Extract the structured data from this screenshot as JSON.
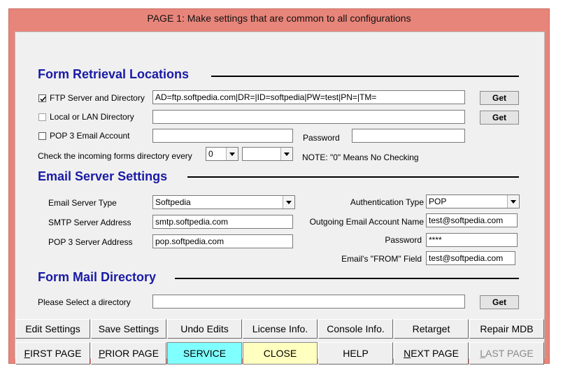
{
  "window": {
    "title": "PAGE 1: Make settings that are common to all configurations"
  },
  "retrieval": {
    "heading": "Form Retrieval Locations",
    "ftp": {
      "label": "FTP Server and Directory",
      "checked": true,
      "value": "AD=ftp.softpedia.com|DR=|ID=softpedia|PW=test|PN=|TM=",
      "get_label": "Get"
    },
    "lan": {
      "label": "Local or LAN Directory",
      "checked": false,
      "value": "",
      "get_label": "Get"
    },
    "pop3": {
      "label": "POP 3 Email Account",
      "checked": false,
      "value": "",
      "password_label": "Password",
      "password_value": ""
    },
    "check": {
      "label": "Check the incoming forms directory every",
      "interval_value": "0",
      "unit_value": "",
      "note": "NOTE: \"0\" Means No Checking"
    }
  },
  "email": {
    "heading": "Email Server Settings",
    "server_type_label": "Email Server Type",
    "server_type_value": "Softpedia",
    "smtp_label": "SMTP Server Address",
    "smtp_value": "smtp.softpedia.com",
    "pop3_label": "POP 3 Server Address",
    "pop3_value": "pop.softpedia.com",
    "auth_type_label": "Authentication Type",
    "auth_type_value": "POP",
    "outgoing_label": "Outgoing Email Account Name",
    "outgoing_value": "test@softpedia.com",
    "password_label": "Password",
    "password_value": "****",
    "from_label": "Email's \"FROM\" Field",
    "from_value": "test@softpedia.com"
  },
  "mail_dir": {
    "heading": "Form Mail Directory",
    "label": "Please Select a directory",
    "value": "",
    "get_label": "Get"
  },
  "toolbar_top": [
    "Edit Settings",
    "Save Settings",
    "Undo Edits",
    "License Info.",
    "Console Info.",
    "Retarget",
    "Repair MDB"
  ],
  "toolbar_bottom": [
    "FIRST PAGE",
    "PRIOR PAGE",
    "SERVICE",
    "CLOSE",
    "HELP",
    "NEXT PAGE",
    "LAST PAGE"
  ],
  "colors": {
    "frame": "#e8857a",
    "heading": "#1a1aa6",
    "service": "#80ffff",
    "close": "#ffffc0",
    "disabled": "#8a8a8a"
  }
}
